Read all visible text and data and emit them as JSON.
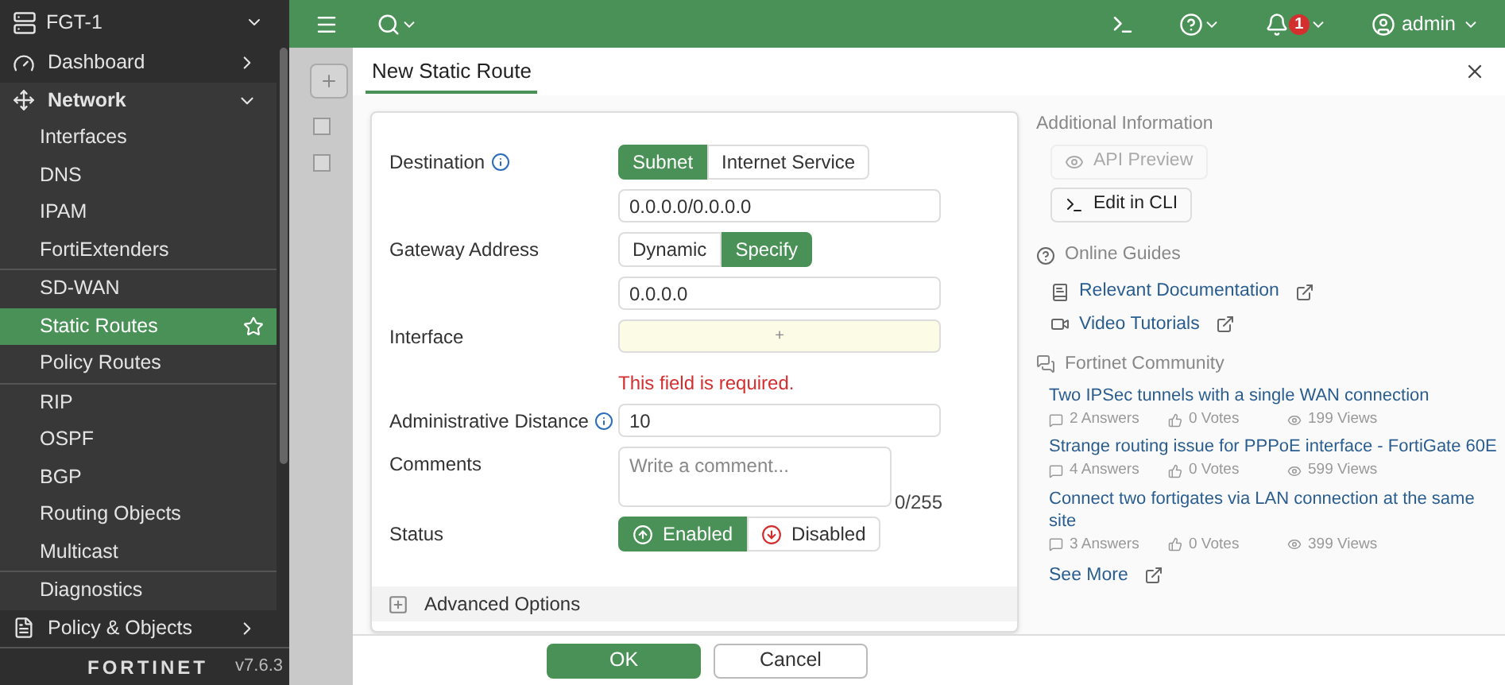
{
  "sidebar": {
    "device": "FGT-1",
    "items": [
      {
        "kind": "dashboard",
        "label": "Dashboard",
        "expanded": false
      },
      {
        "kind": "network",
        "label": "Network",
        "expanded": true,
        "groups": [
          {
            "items": [
              {
                "label": "Interfaces",
                "selected": false
              },
              {
                "label": "DNS",
                "selected": false
              },
              {
                "label": "IPAM",
                "selected": false
              },
              {
                "label": "FortiExtenders",
                "selected": false
              }
            ]
          },
          {
            "items": [
              {
                "label": "SD-WAN",
                "selected": false
              },
              {
                "label": "Static Routes",
                "selected": true
              },
              {
                "label": "Policy Routes",
                "selected": false
              }
            ]
          },
          {
            "items": [
              {
                "label": "RIP",
                "selected": false
              },
              {
                "label": "OSPF",
                "selected": false
              },
              {
                "label": "BGP",
                "selected": false
              },
              {
                "label": "Routing Objects",
                "selected": false
              },
              {
                "label": "Multicast",
                "selected": false
              }
            ]
          },
          {
            "items": [
              {
                "label": "Diagnostics",
                "selected": false
              }
            ]
          }
        ]
      },
      {
        "kind": "policy",
        "label": "Policy & Objects",
        "expanded": false
      }
    ],
    "logo": "FORTINET",
    "version": "v7.6.3"
  },
  "topbar": {
    "notifications": "1",
    "user": "admin"
  },
  "background_list": {
    "rows": [
      {
        "checked": false
      },
      {
        "checked": false
      }
    ]
  },
  "dialog": {
    "title": "New Static Route",
    "fields": [
      {
        "kind": "segmented",
        "label": "Destination",
        "info": true,
        "options": [
          {
            "label": "Subnet",
            "selected": true
          },
          {
            "label": "Internet Service",
            "selected": false
          }
        ]
      },
      {
        "kind": "input",
        "value": "0.0.0.0/0.0.0.0"
      },
      {
        "kind": "segmented",
        "label": "Gateway Address",
        "options": [
          {
            "label": "Dynamic",
            "selected": false
          },
          {
            "label": "Specify",
            "selected": true
          }
        ]
      },
      {
        "kind": "input",
        "value": "0.0.0.0"
      },
      {
        "kind": "picker",
        "label": "Interface",
        "symbol": "+",
        "error": "This field is required."
      },
      {
        "kind": "input",
        "label": "Administrative Distance",
        "info": true,
        "value": "10"
      },
      {
        "kind": "textarea",
        "label": "Comments",
        "placeholder": "Write a comment...",
        "counter": "0/255"
      },
      {
        "kind": "status",
        "label": "Status",
        "options": [
          {
            "label": "Enabled",
            "selected": true
          },
          {
            "label": "Disabled",
            "selected": false
          }
        ]
      }
    ],
    "advanced": {
      "label": "Advanced Options",
      "expanded": false
    },
    "side": {
      "title": "Additional Information",
      "buttons": [
        {
          "kind": "preview",
          "label": "API Preview",
          "disabled": true
        },
        {
          "kind": "cli",
          "label": "Edit in CLI",
          "disabled": false
        }
      ],
      "guides_title": "Online Guides",
      "guides": [
        {
          "kind": "doc",
          "label": "Relevant Documentation"
        },
        {
          "kind": "video",
          "label": "Video Tutorials"
        }
      ],
      "community_title": "Fortinet Community",
      "posts": [
        {
          "title": "Two IPSec tunnels with a single WAN connection",
          "answers": "2 Answers",
          "votes": "0 Votes",
          "views": "199 Views"
        },
        {
          "title": "Strange routing issue for PPPoE interface - FortiGate 60E",
          "answers": "4 Answers",
          "votes": "0 Votes",
          "views": "599 Views"
        },
        {
          "title": "Connect two fortigates via LAN connection at the same site",
          "answers": "3 Answers",
          "votes": "0 Votes",
          "views": "399 Views"
        }
      ],
      "see_more": "See More"
    },
    "actions": [
      {
        "label": "OK",
        "primary": true
      },
      {
        "label": "Cancel",
        "primary": false
      }
    ]
  }
}
